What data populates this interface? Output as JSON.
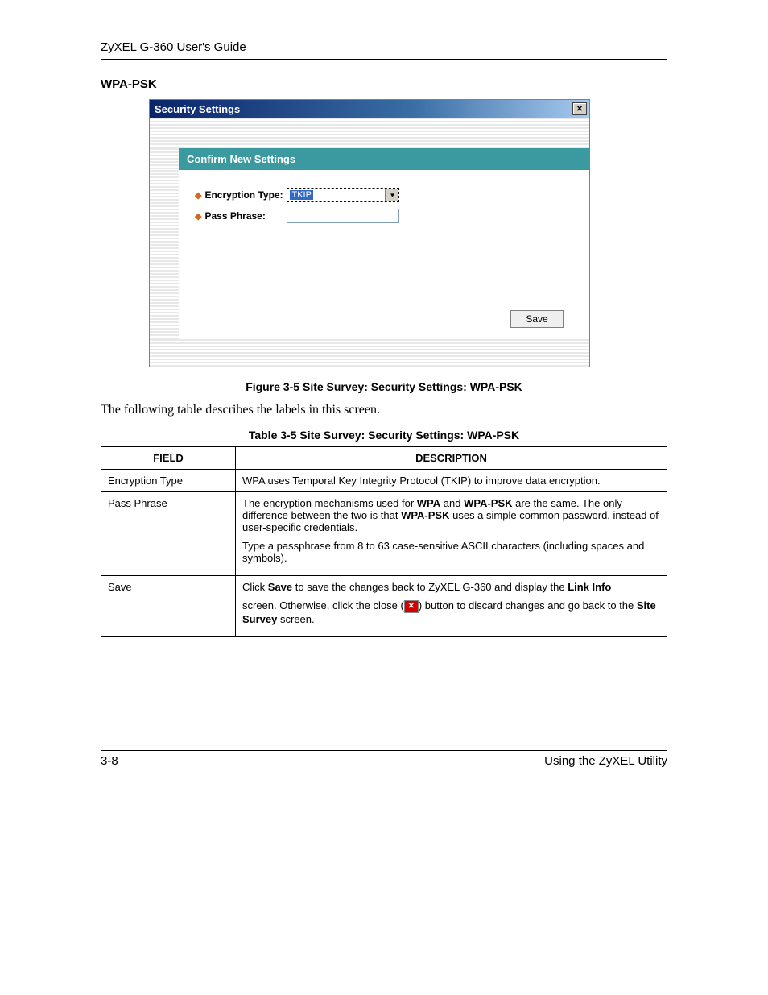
{
  "header": {
    "guide": "ZyXEL G-360 User's Guide"
  },
  "section": {
    "title": "WPA-PSK"
  },
  "dialog": {
    "title": "Security Settings",
    "confirm_heading": "Confirm New Settings",
    "encryption_label": "Encryption Type:",
    "encryption_value": "TKIP",
    "passphrase_label": "Pass Phrase:",
    "save_label": "Save"
  },
  "figure_caption": "Figure 3-5 Site Survey: Security Settings: WPA-PSK",
  "intro_text": "The following table describes the labels in this screen.",
  "table_caption": "Table 3-5 Site Survey: Security Settings: WPA-PSK",
  "table": {
    "headers": {
      "field": "FIELD",
      "description": "DESCRIPTION"
    },
    "rows": [
      {
        "field": "Encryption Type",
        "desc_plain": "WPA uses Temporal Key Integrity Protocol (TKIP) to improve data encryption."
      },
      {
        "field": "Pass Phrase",
        "p1_a": "The encryption mechanisms used for ",
        "p1_b1": "WPA",
        "p1_c": " and ",
        "p1_b2": "WPA-PSK",
        "p1_d": " are the same. The only difference between the two is that ",
        "p1_b3": "WPA-PSK",
        "p1_e": " uses a simple common password, instead of user-specific credentials.",
        "p2": "Type a passphrase from 8 to 63 case-sensitive ASCII characters (including spaces and symbols)."
      },
      {
        "field": "Save",
        "p1_a": "Click ",
        "p1_b1": "Save",
        "p1_c": " to save the changes back to ZyXEL G-360 and display the ",
        "p1_b2": "Link Info",
        "p2_a": "screen. Otherwise, click the close (",
        "p2_b": ") button to discard changes and go back to the ",
        "p2_bold": "Site Survey",
        "p2_c": " screen."
      }
    ]
  },
  "footer": {
    "page": "3-8",
    "section": "Using the ZyXEL Utility"
  }
}
